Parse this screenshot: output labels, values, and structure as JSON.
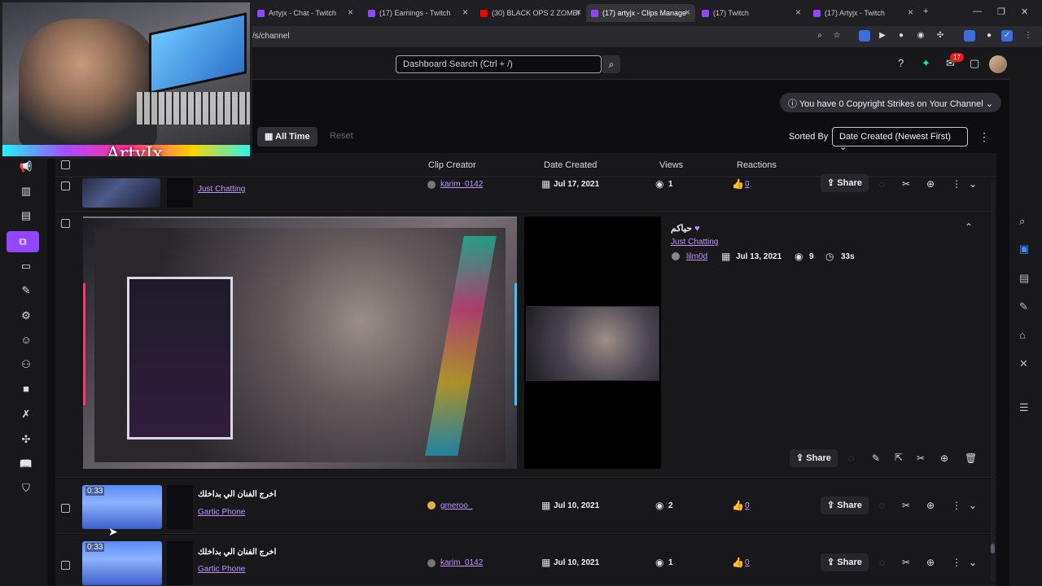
{
  "browser": {
    "tabs": [
      {
        "label": "Artyjx - Chat - Twitch"
      },
      {
        "label": "(17) Earnings - Twitch"
      },
      {
        "label": "(30) BLACK OPS 2 ZOMBI"
      },
      {
        "label": "(17) artyjx - Clips Manage"
      },
      {
        "label": "(17) Twitch"
      },
      {
        "label": "(17) Artyjx - Twitch"
      }
    ],
    "url_fragment": "/s/channel"
  },
  "overlay": {
    "streamer_name": "ArtyJx"
  },
  "topnav": {
    "search_placeholder": "Dashboard Search (Ctrl + /)",
    "notification_count": "17"
  },
  "toolbar": {
    "copyright_text": "You have 0 Copyright Strikes on Your Channel",
    "all_time_label": "All Time",
    "reset_label": "Reset",
    "sorted_by_label": "Sorted By",
    "sort_value": "Date Created (Newest First)"
  },
  "table": {
    "headers": {
      "clip_creator": "Clip Creator",
      "date_created": "Date Created",
      "views": "Views",
      "reactions": "Reactions"
    },
    "rows": [
      {
        "title": "",
        "category": "Just Chatting",
        "creator": "karim_0142",
        "date": "Jul 17, 2021",
        "views": "1",
        "reactions": "0",
        "share": "Share"
      },
      {
        "title": "حياكم",
        "category": "Just Chatting",
        "creator": "lilm0d",
        "date": "Jul 13, 2021",
        "views": "9",
        "duration": "33s",
        "share": "Share"
      },
      {
        "title": "اخرج الفنان الي بداخلك",
        "category": "Gartic Phone",
        "creator": "gmeroo_",
        "date": "Jul 10, 2021",
        "views": "2",
        "reactions": "0",
        "duration": "0:33",
        "share": "Share"
      },
      {
        "title": "اخرج الفنان الي بداخلك",
        "category": "Gartic Phone",
        "creator": "karim_0142",
        "date": "Jul 10, 2021",
        "views": "1",
        "reactions": "0",
        "duration": "0:33",
        "share": "Share"
      }
    ]
  },
  "colors": {
    "accent": "#9147ff",
    "link": "#bf94ff",
    "bg": "#0e0e10",
    "panel": "#18181b"
  }
}
